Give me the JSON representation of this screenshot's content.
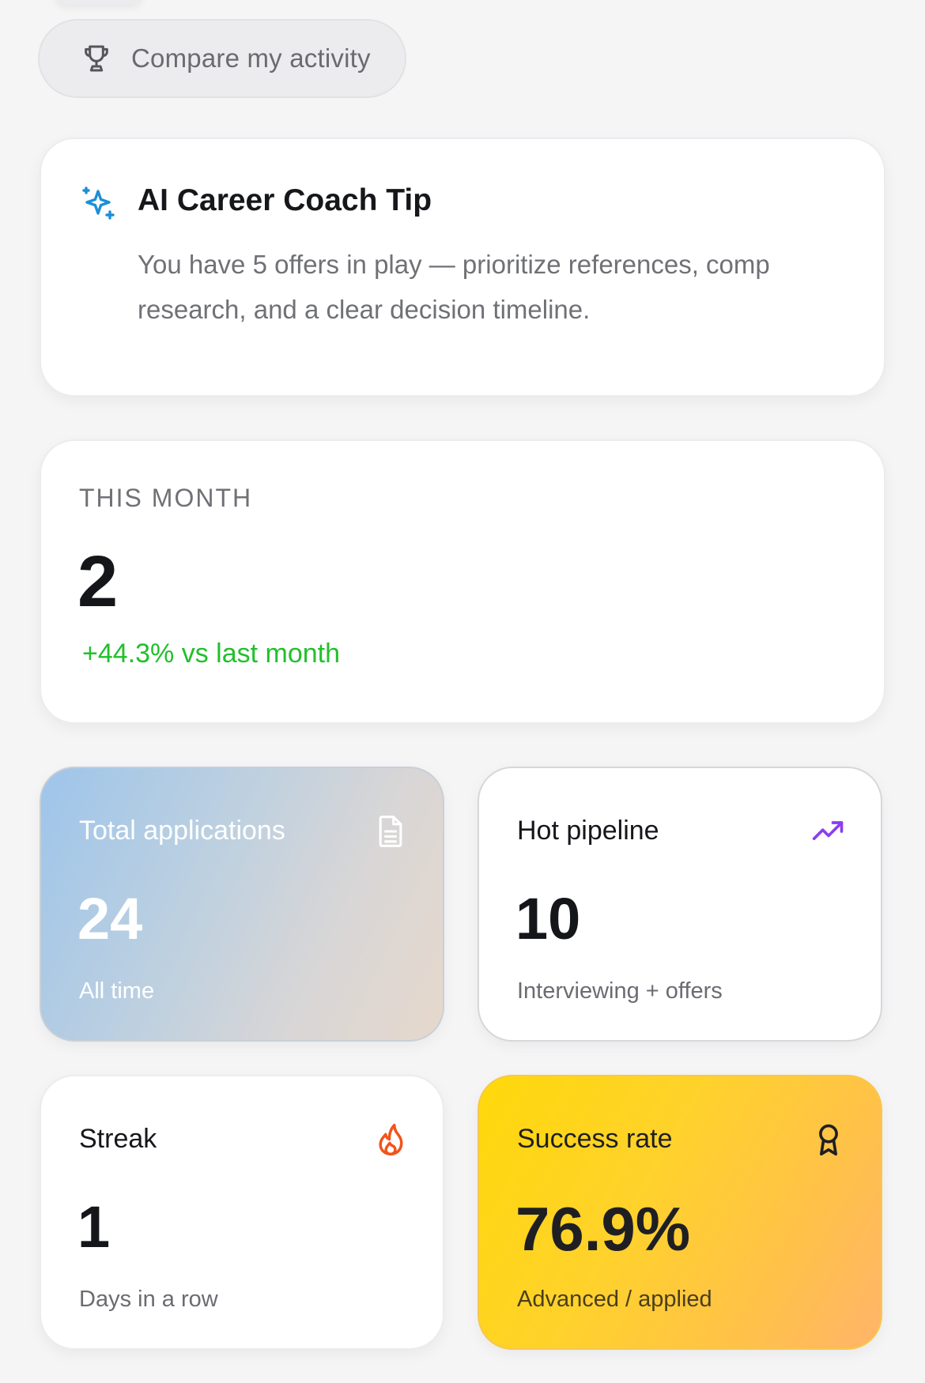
{
  "compare_button": {
    "label": "Compare my activity",
    "icon": "trophy-icon"
  },
  "tip": {
    "icon": "sparkle-icon",
    "title": "AI Career Coach Tip",
    "body": "You have 5 offers in play — prioritize references, comp research, and a clear decision timeline."
  },
  "this_month": {
    "label": "THIS MONTH",
    "value": "2",
    "delta": "+44.3% vs last month"
  },
  "stats": {
    "total_applications": {
      "label": "Total applications",
      "value": "24",
      "sub": "All time",
      "icon": "document-icon"
    },
    "hot_pipeline": {
      "label": "Hot pipeline",
      "value": "10",
      "sub": "Interviewing + offers",
      "icon": "trending-up-icon"
    },
    "streak": {
      "label": "Streak",
      "value": "1",
      "sub": "Days in a row",
      "icon": "flame-icon"
    },
    "success_rate": {
      "label": "Success rate",
      "value": "76.9%",
      "sub": "Advanced / applied",
      "icon": "award-icon"
    }
  },
  "colors": {
    "accent_blue": "#1b8fd8",
    "positive_green": "#22c02b",
    "trend_purple": "#8b3df0",
    "flame_orange": "#f2541b"
  }
}
